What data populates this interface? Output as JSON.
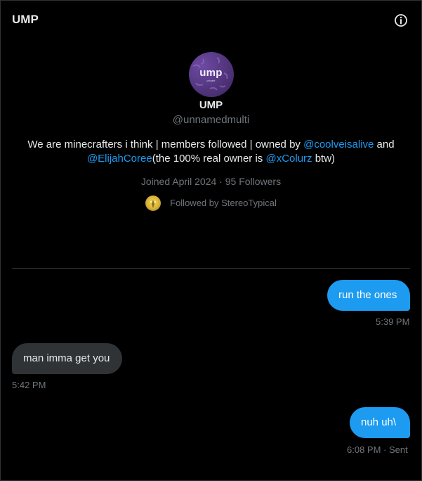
{
  "header": {
    "title": "UMP",
    "info_icon": "info-circle-icon"
  },
  "profile": {
    "avatar_text": "ump",
    "avatar_subtext": "private",
    "display_name": "UMP",
    "handle": "@unnamedmulti",
    "bio": {
      "part1": "We are minecrafters i think | members followed | owned by ",
      "mention1": "@coolveisalive",
      "part2": " and",
      "mention2": "@ElijahCoree",
      "part3": "(the 100% real owner is ",
      "mention3": "@xColurz",
      "part4": " btw)"
    },
    "meta": "Joined April 2024 · 95 Followers",
    "followed_by": "Followed by StereoTypical"
  },
  "messages": [
    {
      "text": "run the ones",
      "time": "5:39 PM",
      "direction": "sent"
    },
    {
      "text": "man imma get you",
      "time": "5:42 PM",
      "direction": "received"
    },
    {
      "text": "nuh uh\\",
      "time": "6:08 PM · Sent",
      "direction": "sent"
    }
  ],
  "colors": {
    "accent": "#1d9bf0",
    "received_bubble": "#2f3336",
    "muted": "#71767b",
    "background": "#000000"
  }
}
